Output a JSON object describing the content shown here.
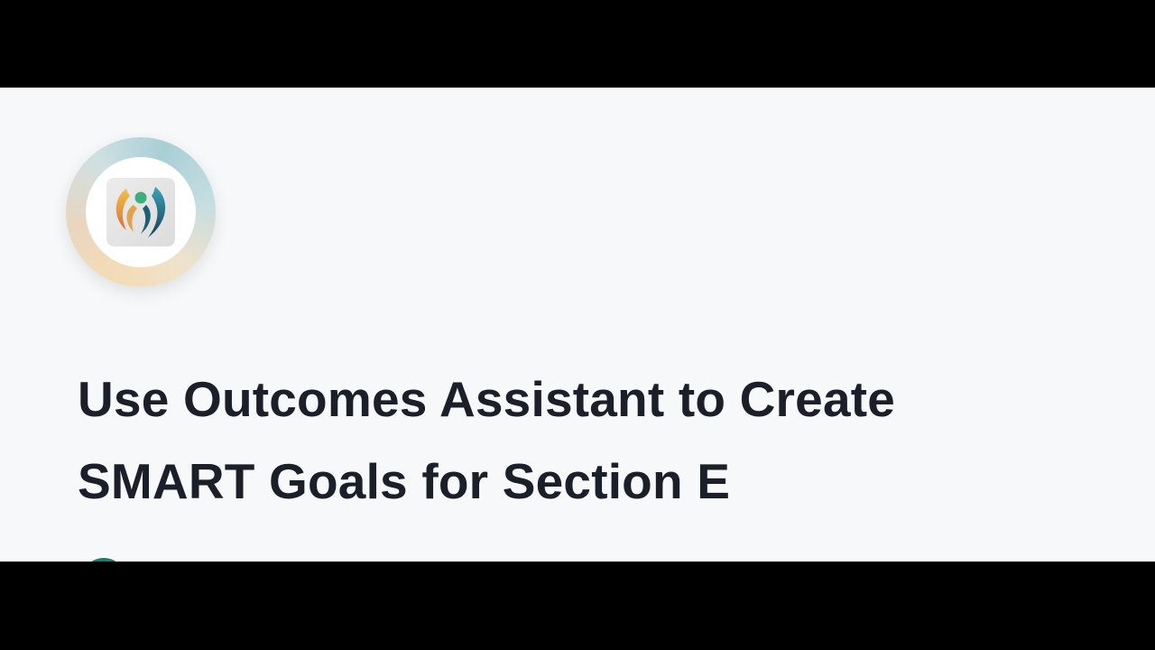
{
  "page": {
    "title_lines": [
      "Use Outcomes Assistant to Create",
      "SMART Goals for Section E"
    ]
  },
  "logo": {
    "icon": "human-figure-leaf-icon",
    "colors": {
      "ring_warm": "#f3dcb6",
      "ring_cool": "#a9cfd6",
      "figure_head": "#3fae7e",
      "left_swoosh": "#e8a43a",
      "right_swoosh": "#1f5e73"
    }
  },
  "colors": {
    "background": "#f7f8fa",
    "title_text": "#1b1f2a",
    "letterbox": "#000000",
    "avatar": "#1f7a6e"
  }
}
